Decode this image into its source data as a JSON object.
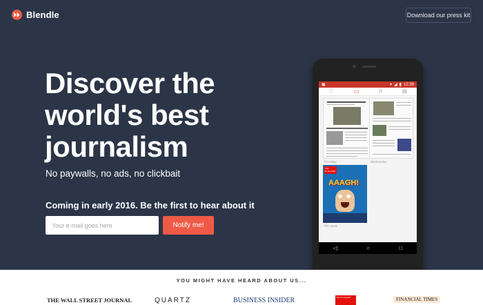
{
  "header": {
    "brand": "Blendle",
    "press_kit_label": "Download our press kit"
  },
  "hero": {
    "headline_lines": [
      "Discover the",
      "world's best",
      "journalism"
    ],
    "subheadline": "No paywalls, no ads, no clickbait",
    "coming_soon": "Coming in early 2016. Be the first to hear about it",
    "email_placeholder": "Your e-mail goes here",
    "notify_label": "Notify me!"
  },
  "phone": {
    "status_time": "12:39",
    "section_labels": [
      "Thursday",
      "Wednesday",
      "This week"
    ],
    "magazine_title": "The Economist",
    "magazine_headline": "AAAGH!"
  },
  "press": {
    "heading": "YOU MIGHT HAVE HEARD ABOUT US...",
    "outlets": [
      "THE WALL STREET JOURNAL",
      "QUARTZ",
      "BUSINESS INSIDER",
      "The Economist",
      "FINANCIAL TIMES"
    ]
  },
  "colors": {
    "hero_bg": "#2b3547",
    "accent": "#ef5a47",
    "status_bar": "#c7352a"
  }
}
